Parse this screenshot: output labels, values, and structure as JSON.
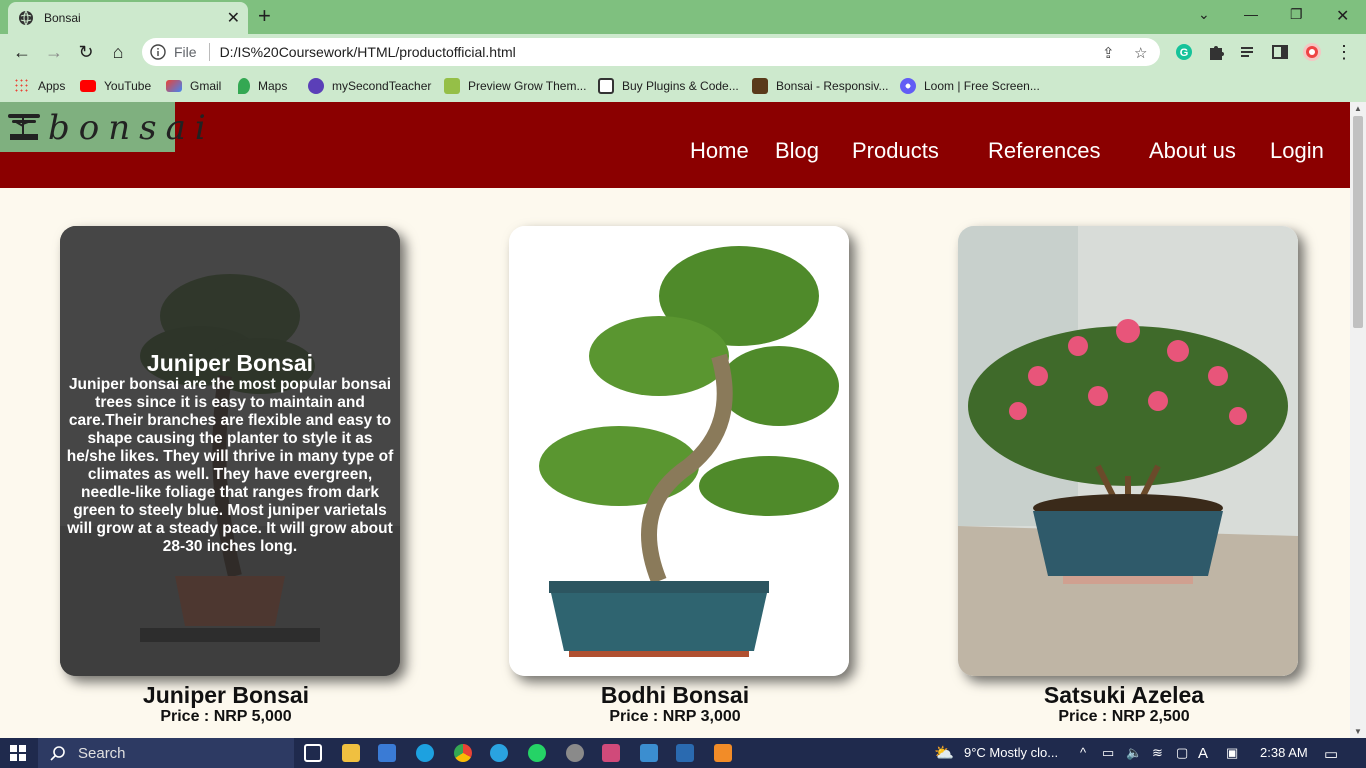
{
  "browser": {
    "tab_title": "Bonsai",
    "tab_close": "✕",
    "new_tab": "+",
    "address_prefix": "File",
    "url": "D:/IS%20Coursework/HTML/productofficial.html",
    "bookmarks": [
      {
        "label": "Apps",
        "icon": "apps-grid-icon",
        "color": "#e94235"
      },
      {
        "label": "YouTube",
        "icon": "youtube-icon",
        "color": "#ff0000"
      },
      {
        "label": "Gmail",
        "icon": "gmail-icon",
        "color": "#d93025"
      },
      {
        "label": "Maps",
        "icon": "maps-icon",
        "color": "#34a853"
      },
      {
        "label": "mySecondTeacher",
        "icon": "mysecondteacher-icon",
        "color": "#5b3fb8"
      },
      {
        "label": "Preview Grow Them...",
        "icon": "shopify-icon",
        "color": "#95bf47"
      },
      {
        "label": "Buy Plugins & Code...",
        "icon": "plugins-icon",
        "color": "#333333"
      },
      {
        "label": "Bonsai - Responsiv...",
        "icon": "bonsai-site-icon",
        "color": "#5a3a1a"
      },
      {
        "label": "Loom | Free Screen...",
        "icon": "loom-icon",
        "color": "#625df5"
      }
    ]
  },
  "site": {
    "logo_text": "bonsai",
    "nav": [
      "Home",
      "Blog",
      "Products",
      "References",
      "About us",
      "Login"
    ],
    "header_color": "#8b0000",
    "logo_bg": "#7fb07f"
  },
  "products": [
    {
      "name": "Juniper Bonsai",
      "price": "Price : NRP 5,000",
      "overlay_title": "Juniper Bonsai",
      "overlay_text": "Juniper bonsai are the most popular bonsai trees since it is easy to maintain and care.Their branches are flexible and easy to shape causing the planter to style it as he/she likes. They will thrive in many type of climates as well. They have evergreen, needle-like foliage that ranges from dark green to steely blue. Most juniper varietals will grow at a steady pace. It will grow about 28-30 inches long."
    },
    {
      "name": "Bodhi Bonsai",
      "price": "Price : NRP 3,000"
    },
    {
      "name": "Satsuki Azelea",
      "price": "Price : NRP 2,500"
    }
  ],
  "taskbar": {
    "search_placeholder": "Search",
    "weather": "9°C  Mostly clo...",
    "time": "2:38 AM",
    "lang": "A"
  }
}
